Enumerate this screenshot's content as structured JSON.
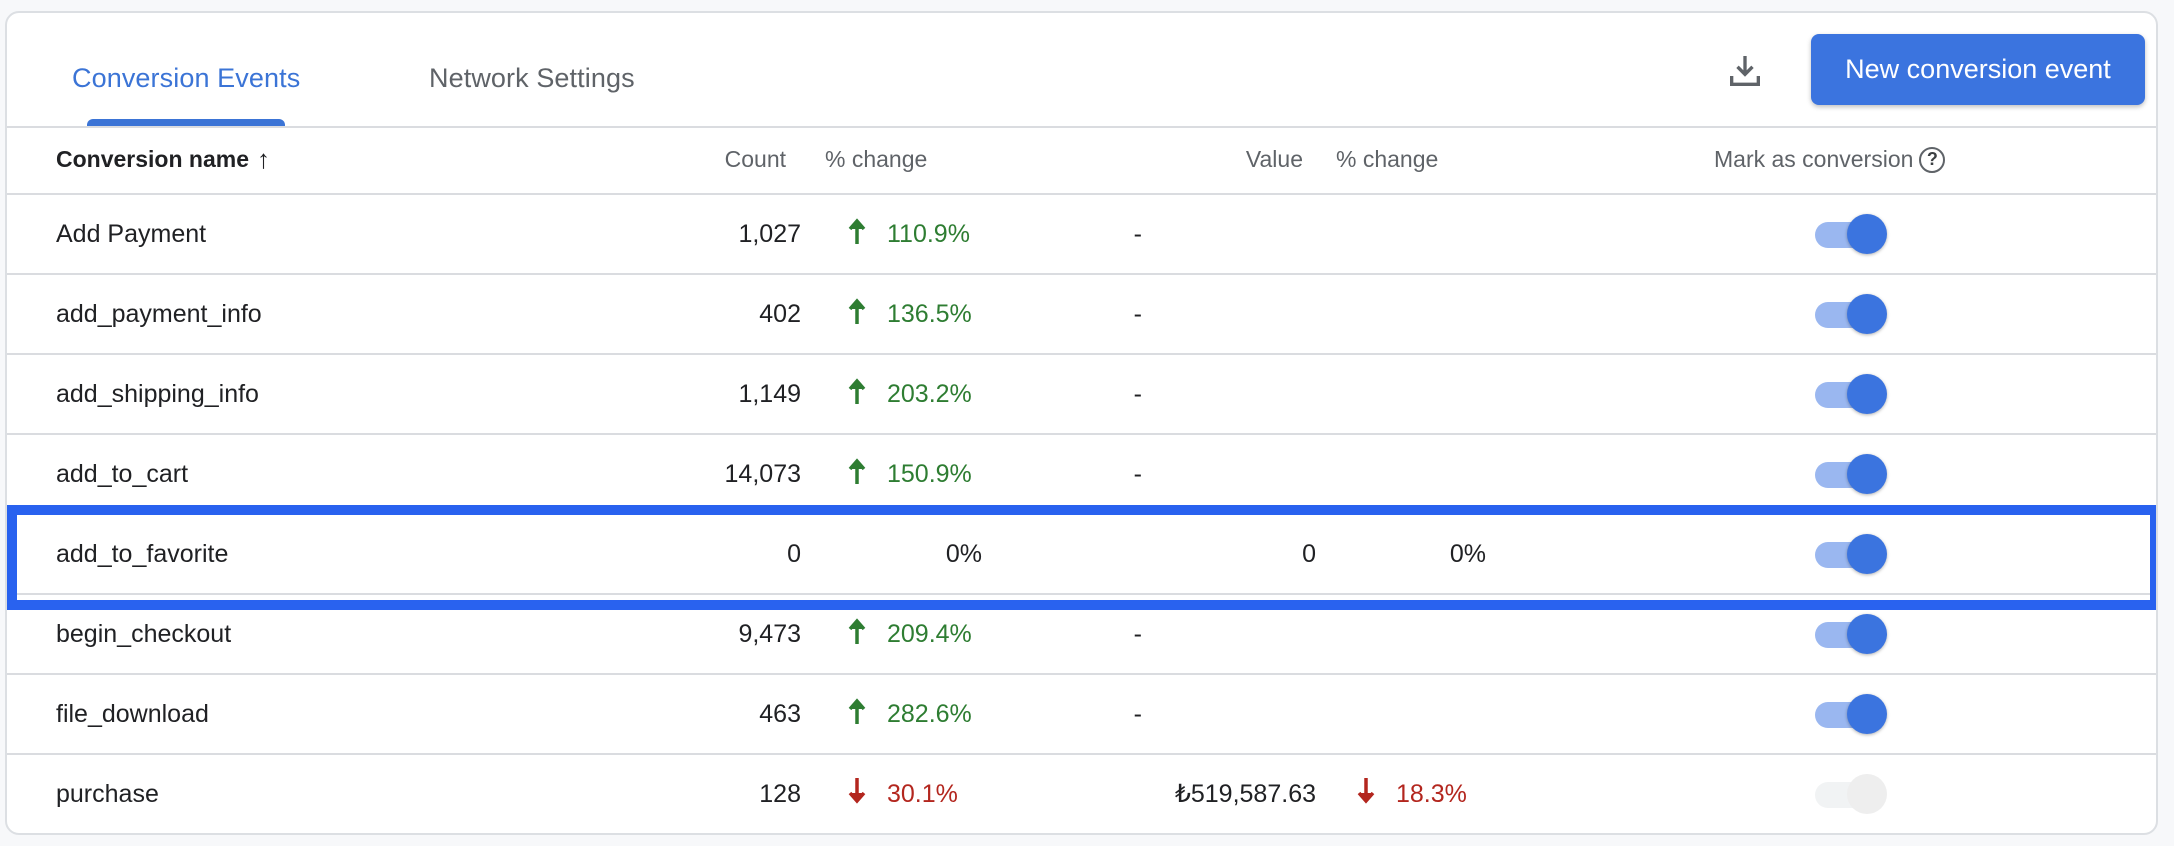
{
  "tabs": [
    {
      "label": "Conversion Events",
      "active": true
    },
    {
      "label": "Network Settings",
      "active": false
    }
  ],
  "toolbar": {
    "download_icon": "download-icon",
    "new_button_label": "New conversion event"
  },
  "colors": {
    "accent": "#3b74df",
    "positive": "#2e7d32",
    "negative": "#b3261e",
    "highlight": "#2962ef"
  },
  "table": {
    "headers": {
      "name": "Conversion name",
      "name_sort_icon": "↑",
      "count": "Count",
      "count_change": "% change",
      "value": "Value",
      "value_change": "% change",
      "mark": "Mark as conversion",
      "help_icon": "?"
    },
    "rows": [
      {
        "name": "Add Payment",
        "count": "1,027",
        "count_change": "110.9%",
        "count_dir": "up",
        "value": "-",
        "value_change": "",
        "value_dir": "",
        "marked": true,
        "disabled": false
      },
      {
        "name": "add_payment_info",
        "count": "402",
        "count_change": "136.5%",
        "count_dir": "up",
        "value": "-",
        "value_change": "",
        "value_dir": "",
        "marked": true,
        "disabled": false
      },
      {
        "name": "add_shipping_info",
        "count": "1,149",
        "count_change": "203.2%",
        "count_dir": "up",
        "value": "-",
        "value_change": "",
        "value_dir": "",
        "marked": true,
        "disabled": false
      },
      {
        "name": "add_to_cart",
        "count": "14,073",
        "count_change": "150.9%",
        "count_dir": "up",
        "value": "-",
        "value_change": "",
        "value_dir": "",
        "marked": true,
        "disabled": false
      },
      {
        "name": "add_to_favorite",
        "count": "0",
        "count_change": "0%",
        "count_dir": "none",
        "value": "0",
        "value_change": "0%",
        "value_dir": "none",
        "marked": true,
        "disabled": false,
        "highlighted": true
      },
      {
        "name": "begin_checkout",
        "count": "9,473",
        "count_change": "209.4%",
        "count_dir": "up",
        "value": "-",
        "value_change": "",
        "value_dir": "",
        "marked": true,
        "disabled": false
      },
      {
        "name": "file_download",
        "count": "463",
        "count_change": "282.6%",
        "count_dir": "up",
        "value": "-",
        "value_change": "",
        "value_dir": "",
        "marked": true,
        "disabled": false
      },
      {
        "name": "purchase",
        "count": "128",
        "count_change": "30.1%",
        "count_dir": "down",
        "value": "₺519,587.63",
        "value_change": "18.3%",
        "value_dir": "down",
        "marked": true,
        "disabled": true
      }
    ]
  }
}
